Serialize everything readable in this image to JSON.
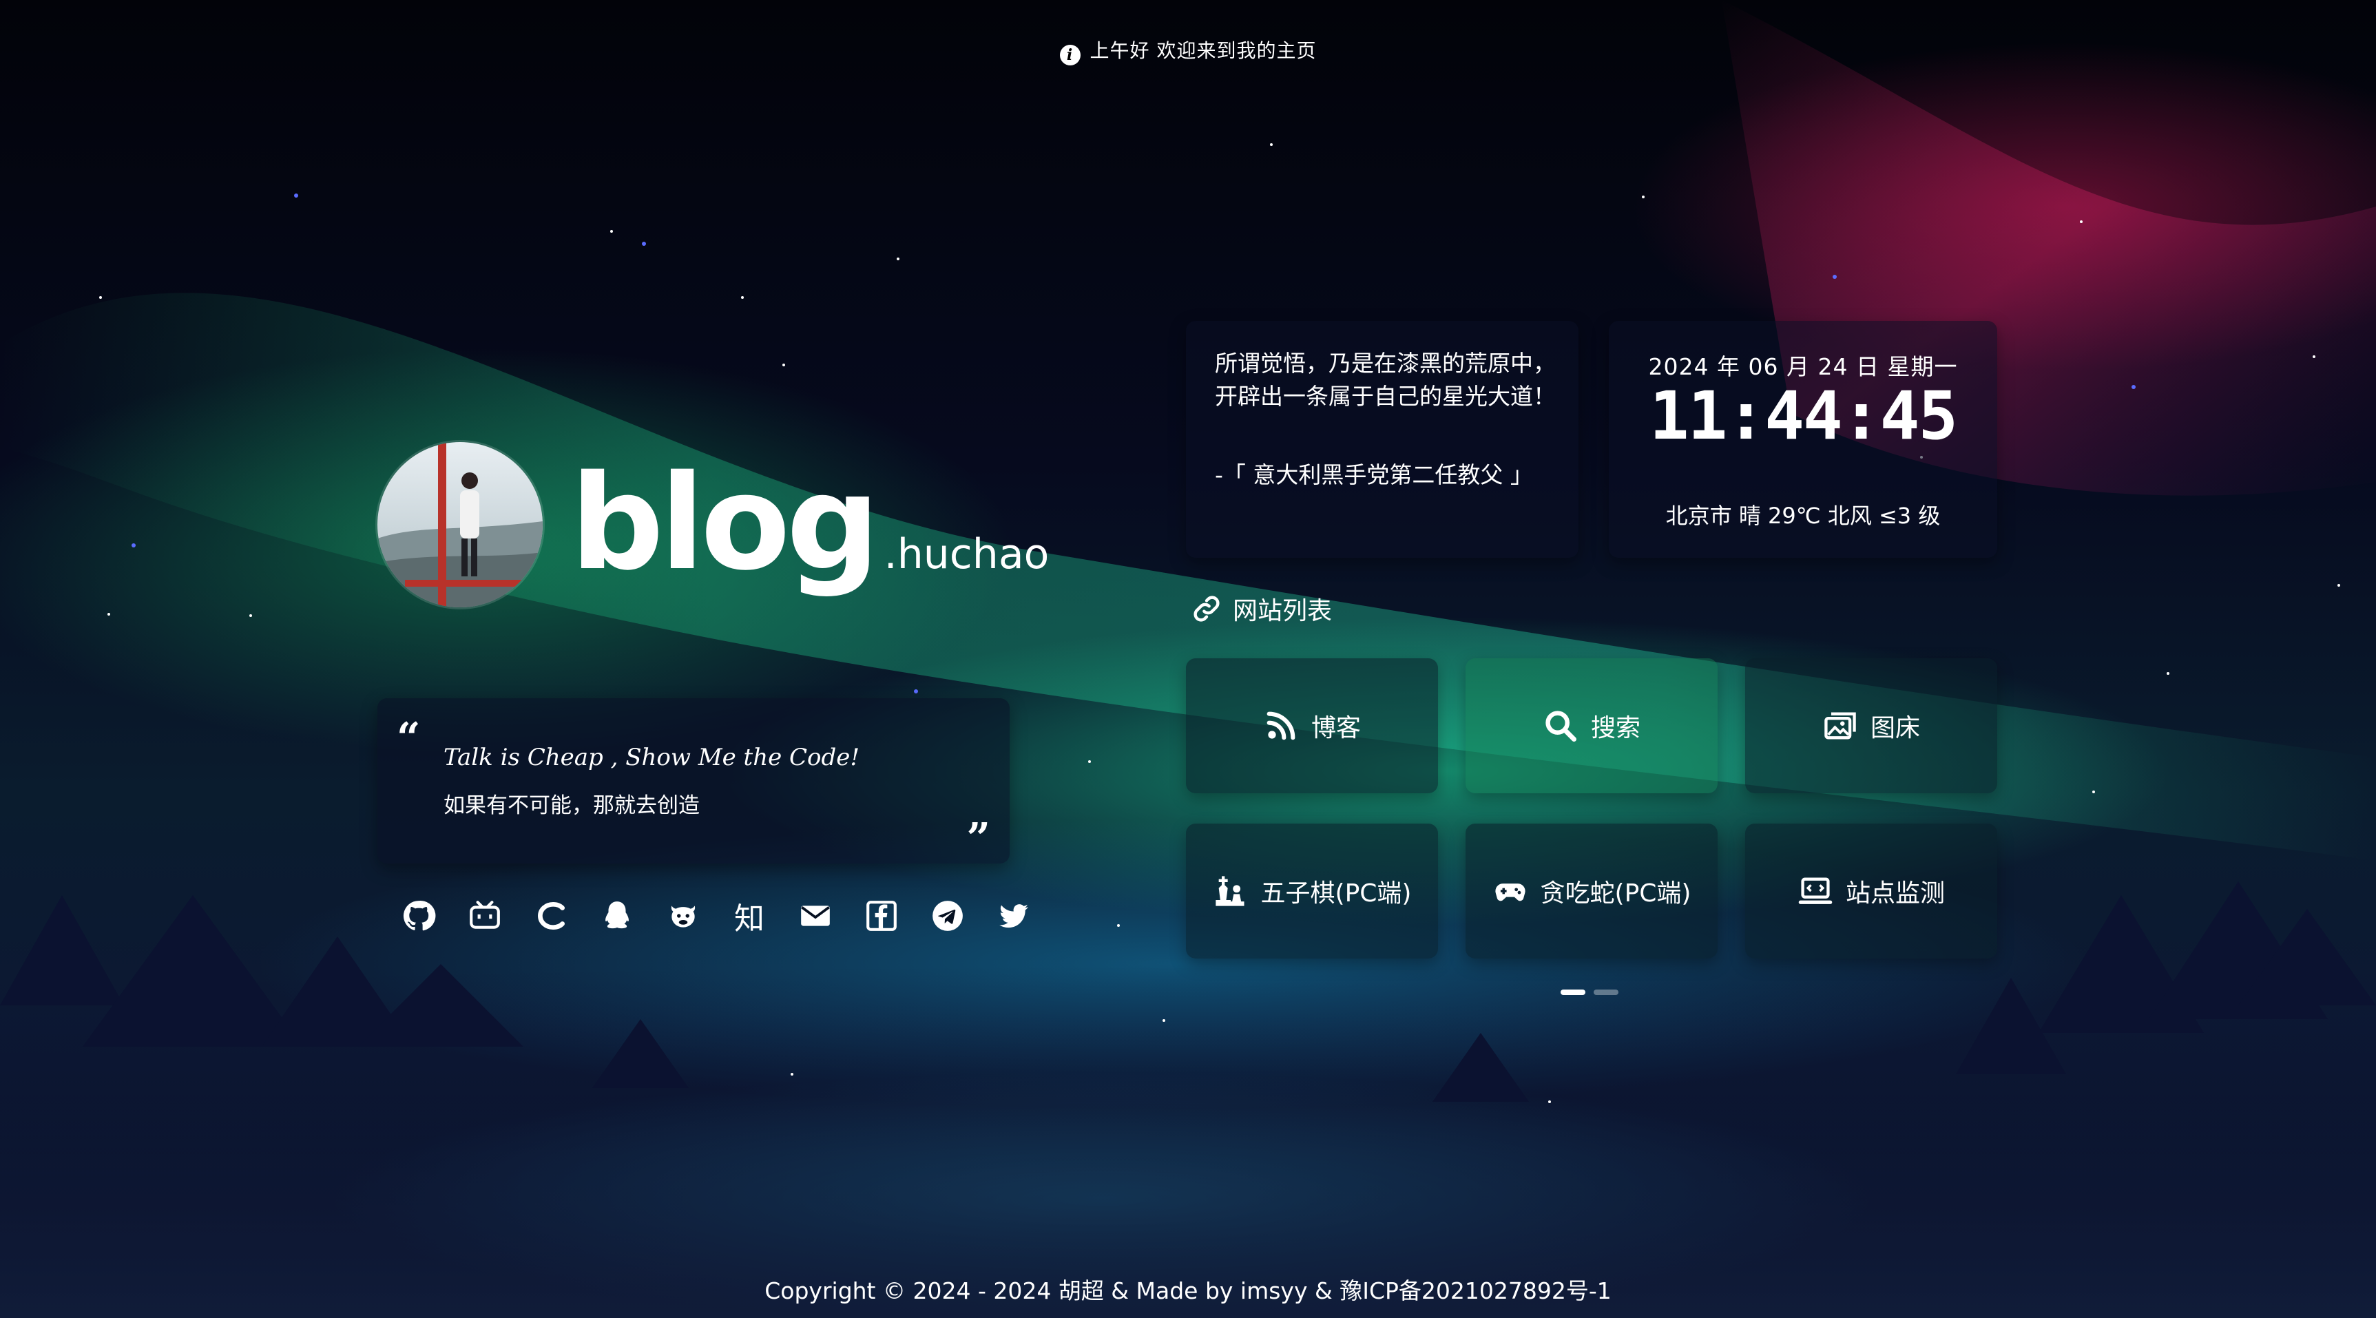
{
  "header": {
    "greeting": "上午好",
    "welcome": "欢迎来到我的主页",
    "info_icon": "info-icon"
  },
  "profile": {
    "logo_main": "blog",
    "logo_sub": ".huchao"
  },
  "motto": {
    "line1": "Talk is Cheap , Show Me the Code!",
    "line2": "如果有不可能，那就去创造"
  },
  "socials": [
    {
      "name": "github-icon"
    },
    {
      "name": "bilibili-icon"
    },
    {
      "name": "csdn-icon"
    },
    {
      "name": "qq-icon"
    },
    {
      "name": "cow-icon"
    },
    {
      "name": "zhihu-icon",
      "text": "知"
    },
    {
      "name": "email-icon"
    },
    {
      "name": "facebook-icon"
    },
    {
      "name": "telegram-icon"
    },
    {
      "name": "twitter-icon"
    }
  ],
  "quote": {
    "text": "所谓觉悟，乃是在漆黑的荒原中，开辟出一条属于自己的星光大道！",
    "source": "-「 意大利黑手党第二任教父 」"
  },
  "clock": {
    "date": "2024 年 06 月 24 日 星期一",
    "time": "11:44:45",
    "weather": "北京市 晴 29℃ 北风 ≤3 级"
  },
  "sites": {
    "title": "网站列表",
    "items": [
      {
        "label": "博客",
        "icon": "blog-icon"
      },
      {
        "label": "搜索",
        "icon": "search-icon"
      },
      {
        "label": "图床",
        "icon": "image-bed-icon"
      },
      {
        "label": "五子棋(PC端)",
        "icon": "chess-icon"
      },
      {
        "label": "贪吃蛇(PC端)",
        "icon": "gamepad-icon"
      },
      {
        "label": "站点监测",
        "icon": "monitor-icon"
      }
    ],
    "page_count": 2,
    "current_page": 1
  },
  "footer": {
    "text": "Copyright © 2024 - 2024 胡超 & Made by imsyy & 豫ICP备2021027892号-1"
  },
  "colors": {
    "accent": "#ffffff",
    "aurora_green": "#1ee6a0",
    "aurora_red": "#aa1446"
  }
}
